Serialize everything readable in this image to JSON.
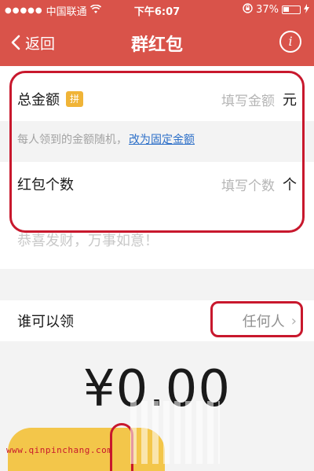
{
  "status_bar": {
    "carrier": "中国联通",
    "time": "下午6:07",
    "battery": "37%",
    "signal_icon": "signal-dots-icon",
    "wifi_icon": "wifi-icon",
    "lock_icon": "rotation-lock-icon",
    "charging_icon": "charging-bolt-icon"
  },
  "nav": {
    "back_label": "返回",
    "title": "群红包",
    "info_glyph": "i"
  },
  "form": {
    "total_amount": {
      "label": "总金额",
      "badge": "拼",
      "placeholder": "填写金额",
      "unit": "元"
    },
    "hint": {
      "text": "每人领到的金额随机，",
      "link": "改为固定金额"
    },
    "count": {
      "label": "红包个数",
      "placeholder": "填写个数",
      "unit": "个"
    },
    "greeting_placeholder": "恭喜发财，万事如意！"
  },
  "who": {
    "label": "谁可以领",
    "value": "任何人",
    "chevron": "›"
  },
  "amount_display": "¥0.00",
  "watermark": "www.qinpinchang.com",
  "colors": {
    "brand_red": "#d9534a",
    "annotation_red": "#c8182d",
    "badge_yellow": "#f0b437",
    "link_blue": "#2c6fc8",
    "button_yellow": "#f3c64a"
  }
}
